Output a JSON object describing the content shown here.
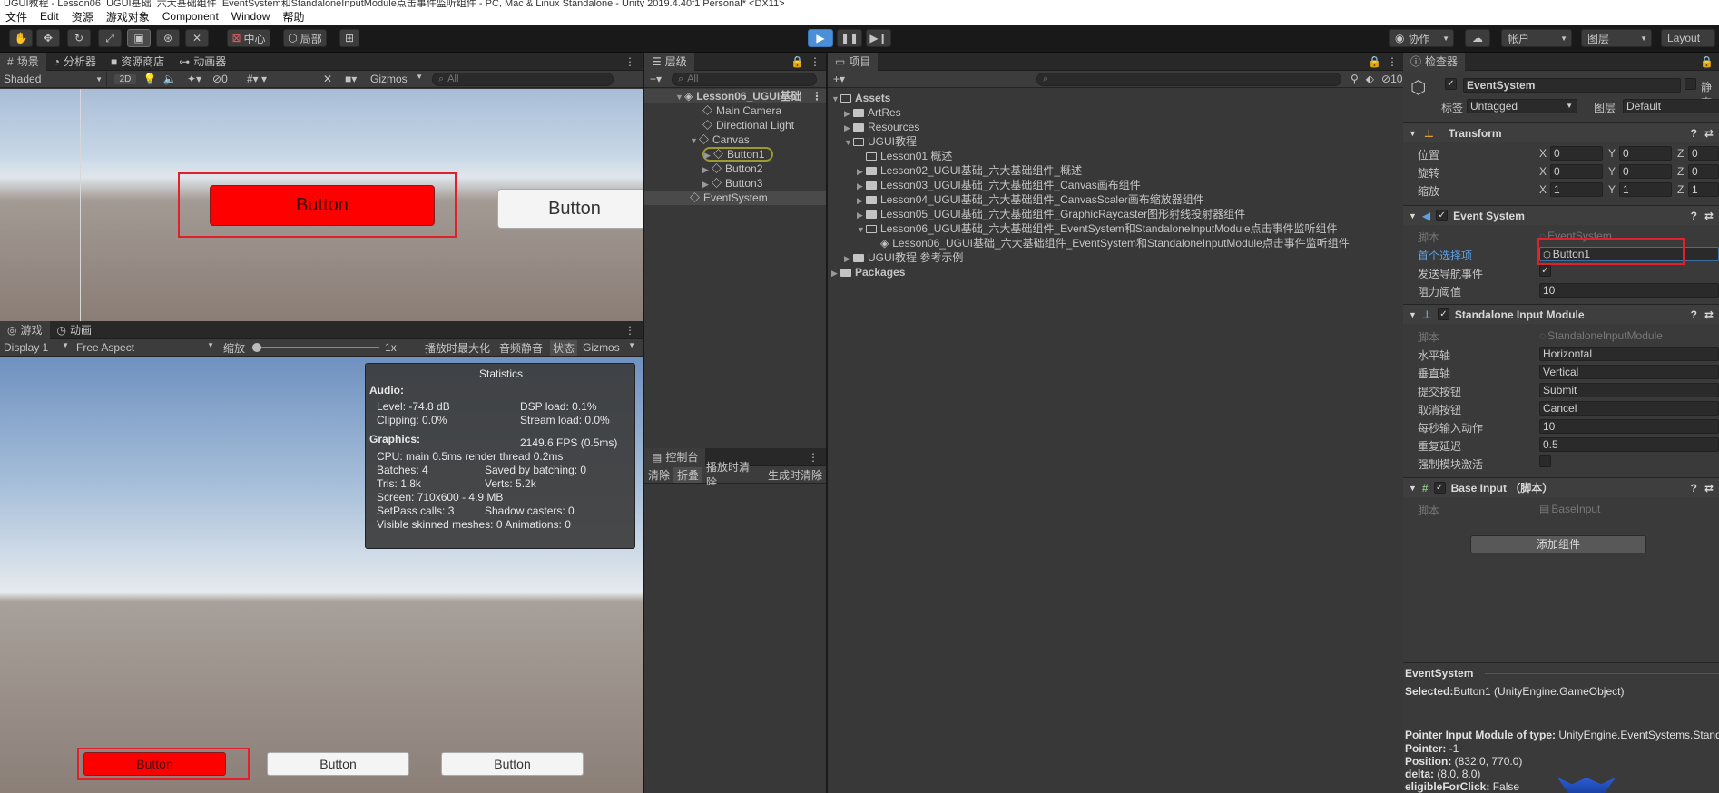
{
  "titlebar": {
    "text": "UGUI教程 - Lesson06_UGUI基础_六大基础组件_EventSystem和StandaloneInputModule点击事件监听组件 - PC, Mac & Linux Standalone - Unity 2019.4.40f1 Personal* <DX11>"
  },
  "menu": [
    "文件",
    "Edit",
    "资源",
    "游戏对象",
    "Component",
    "Window",
    "帮助"
  ],
  "toolbar": {
    "pivot": "中心",
    "space": "局部",
    "collab": "协作",
    "account": "帐户",
    "layers": "图层",
    "layout": "Layout"
  },
  "scene": {
    "tabs": [
      "场景",
      "分析器",
      "资源商店",
      "动画器"
    ],
    "shading": "Shaded",
    "mode2d": "2D",
    "hidden_count": "0",
    "gizmos": "Gizmos",
    "search_placeholder": "All",
    "button_red": "Button",
    "button_white": "Button"
  },
  "game": {
    "tabs": [
      "游戏",
      "动画"
    ],
    "display": "Display 1",
    "aspect": "Free Aspect",
    "scale_label": "缩放",
    "scale_value": "1x",
    "maximize": "播放时最大化",
    "mute": "音频静音",
    "stats": "状态",
    "gizmos": "Gizmos",
    "buttons": [
      "Button",
      "Button",
      "Button"
    ]
  },
  "statistics": {
    "title": "Statistics",
    "audio_head": "Audio:",
    "level": "Level: -74.8 dB",
    "dsp": "DSP load: 0.1%",
    "clipping": "Clipping: 0.0%",
    "stream": "Stream load: 0.0%",
    "graphics_head": "Graphics:",
    "fps": "2149.6 FPS (0.5ms)",
    "cpu": "CPU: main 0.5ms  render thread 0.2ms",
    "batches": "Batches: 4",
    "saved": "Saved by batching: 0",
    "tris": "Tris: 1.8k",
    "verts": "Verts: 5.2k",
    "screen": "Screen: 710x600 - 4.9 MB",
    "setpass": "SetPass calls: 3",
    "shadow": "Shadow casters: 0",
    "skinned": "Visible skinned meshes: 0  Animations: 0"
  },
  "hierarchy": {
    "tab": "层级",
    "search_placeholder": "All",
    "scene_name": "Lesson06_UGUI基础",
    "items": [
      "Main Camera",
      "Directional Light",
      "Canvas",
      "Button1",
      "Button2",
      "Button3",
      "EventSystem"
    ]
  },
  "console": {
    "tab": "控制台",
    "buttons": [
      "清除",
      "折叠",
      "播放时清除",
      "生成时清除"
    ]
  },
  "project": {
    "tab": "项目",
    "hidden_count": "10",
    "items": [
      "Assets",
      "ArtRes",
      "Resources",
      "UGUI教程",
      "Lesson01 概述",
      "Lesson02_UGUI基础_六大基础组件_概述",
      "Lesson03_UGUI基础_六大基础组件_Canvas画布组件",
      "Lesson04_UGUI基础_六大基础组件_CanvasScaler画布缩放器组件",
      "Lesson05_UGUI基础_六大基础组件_GraphicRaycaster图形射线投射器组件",
      "Lesson06_UGUI基础_六大基础组件_EventSystem和StandaloneInputModule点击事件监听组件",
      "Lesson06_UGUI基础_六大基础组件_EventSystem和StandaloneInputModule点击事件监听组件",
      "UGUI教程 参考示例",
      "Packages"
    ]
  },
  "inspector": {
    "tab": "检查器",
    "object_name": "EventSystem",
    "static_label": "静态",
    "tag_label": "标签",
    "tag_value": "Untagged",
    "layer_label": "图层",
    "layer_value": "Default",
    "transform": {
      "title": "Transform",
      "position": "位置",
      "rotation": "旋转",
      "scale": "缩放",
      "x": "X",
      "y": "Y",
      "z": "Z",
      "pos": [
        "0",
        "0",
        "0"
      ],
      "rot": [
        "0",
        "0",
        "0"
      ],
      "scl": [
        "1",
        "1",
        "1"
      ]
    },
    "event_system": {
      "title": "Event System",
      "script_label": "脚本",
      "script_value": "EventSystem",
      "first_selected_label": "首个选择项",
      "first_selected_value": "Button1",
      "send_nav_label": "发送导航事件",
      "drag_threshold_label": "阻力阈值",
      "drag_threshold_value": "10"
    },
    "standalone": {
      "title": "Standalone Input Module",
      "script_label": "脚本",
      "script_value": "StandaloneInputModule",
      "horizontal_label": "水平轴",
      "horizontal_value": "Horizontal",
      "vertical_label": "垂直轴",
      "vertical_value": "Vertical",
      "submit_label": "提交按钮",
      "submit_value": "Submit",
      "cancel_label": "取消按钮",
      "cancel_value": "Cancel",
      "ips_label": "每秒输入动作",
      "ips_value": "10",
      "repeat_label": "重复延迟",
      "repeat_value": "0.5",
      "force_label": "强制模块激活"
    },
    "base_input": {
      "title": "Base Input （脚本）",
      "script_label": "脚本",
      "script_value": "BaseInput"
    },
    "add_component": "添加组件",
    "preview": {
      "title": "EventSystem",
      "selected_label": "Selected:",
      "selected_value": "Button1 (UnityEngine.GameObject)",
      "pointer_module_label": "Pointer Input Module of type:",
      "pointer_module_value": "UnityEngine.EventSystems.StandaloneInputModule",
      "pointer_label": "Pointer:",
      "pointer_value": "-1",
      "position_label": "Position:",
      "position_value": "(832.0, 770.0)",
      "delta_label": "delta:",
      "delta_value": "(8.0, 8.0)",
      "eligible_label": "eligibleForClick:",
      "eligible_value": "False"
    }
  },
  "colors": {
    "red_button": "#ff0000",
    "highlight_box": "#e0202a",
    "selection_blue": "#2c5d87",
    "play_active": "#4a90d9"
  }
}
